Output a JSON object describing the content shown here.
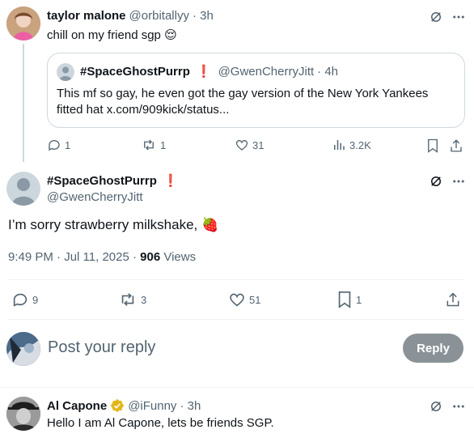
{
  "parent_tweet": {
    "author_name": "taylor malone",
    "author_handle": "@orbitallyy",
    "time": "· 3h",
    "text": "chill on my friend sgp 😌",
    "quoted": {
      "author_name": "#SpaceGhostPurrp",
      "badge": "❗",
      "author_handle": "@GwenCherryJitt",
      "time": "· 4h",
      "text": "This mf so gay, he even got the gay version of the New York Yankees fitted hat x.com/909kick/status..."
    },
    "actions": {
      "replies": "1",
      "reposts": "1",
      "likes": "31",
      "views": "3.2K"
    }
  },
  "main_tweet": {
    "author_name": "#SpaceGhostPurrp",
    "badge": "❗",
    "author_handle": "@GwenCherryJitt",
    "text": "I’m sorry strawberry milkshake, 🍓",
    "timestamp": "9:49 PM · Jul 11, 2025 · ",
    "views_count": "906",
    "views_label": " Views",
    "actions": {
      "replies": "9",
      "reposts": "3",
      "likes": "51",
      "bookmarks": "1"
    }
  },
  "reply_box": {
    "placeholder": "Post your reply",
    "button_label": "Reply"
  },
  "reply_tweet": {
    "author_name": "Al Capone",
    "author_handle": "@iFunny",
    "time": "· 3h",
    "text": "Hello I am Al Capone, lets be friends SGP."
  },
  "colors": {
    "text": "#0f1419",
    "muted": "#536471",
    "badge_red": "#f4212e",
    "verified_gold": "#e2b719",
    "reply_button": "#8a9297",
    "border": "#cfd9de"
  },
  "icons": [
    "grok-icon",
    "more-icon",
    "reply-icon",
    "repost-icon",
    "like-icon",
    "views-icon",
    "bookmark-icon",
    "share-icon",
    "verified-icon"
  ]
}
